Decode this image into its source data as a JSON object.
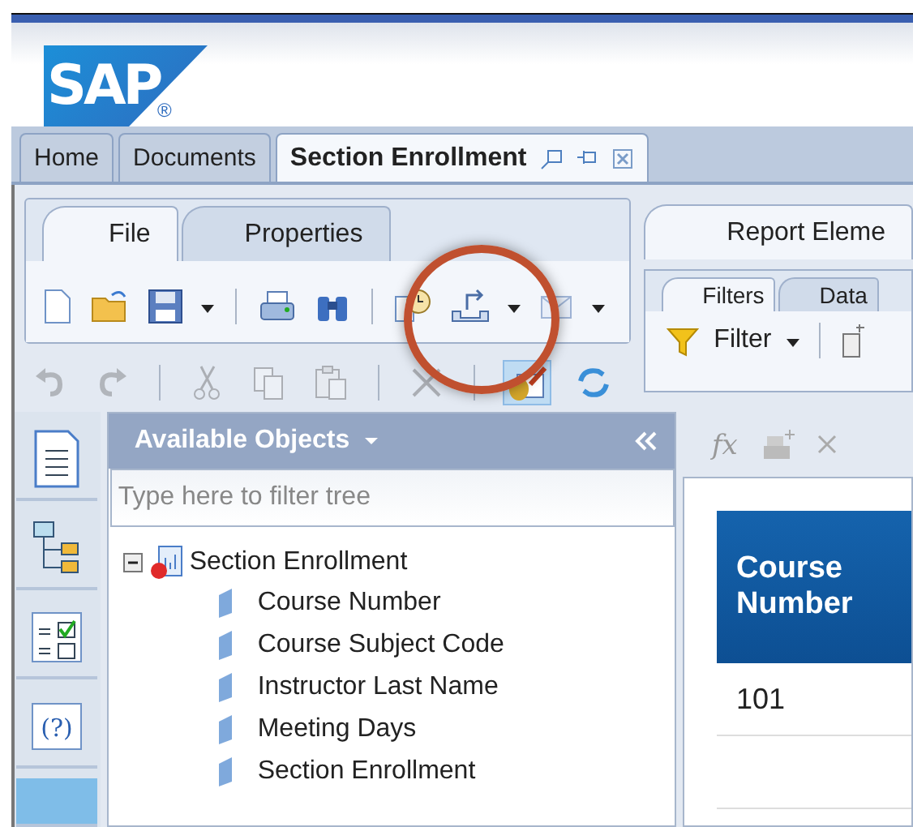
{
  "logo": {
    "text": "SAP",
    "mark": "®"
  },
  "tabs": [
    {
      "label": "Home",
      "selected": false
    },
    {
      "label": "Documents",
      "selected": false
    },
    {
      "label": "Section Enrollment",
      "selected": true
    }
  ],
  "ribbon_tabs": [
    {
      "label": "File",
      "selected": true
    },
    {
      "label": "Properties",
      "selected": false
    }
  ],
  "toolbar_row1": [
    {
      "kind": "new"
    },
    {
      "kind": "open"
    },
    {
      "kind": "save"
    },
    {
      "kind": "caret"
    },
    {
      "kind": "sep"
    },
    {
      "kind": "print"
    },
    {
      "kind": "find"
    },
    {
      "kind": "sep"
    },
    {
      "kind": "schedule"
    },
    {
      "kind": "export"
    },
    {
      "kind": "caret"
    },
    {
      "kind": "mail"
    },
    {
      "kind": "caret"
    }
  ],
  "toolbar_row2": [
    {
      "kind": "undo",
      "disabled": true
    },
    {
      "kind": "redo",
      "disabled": true
    },
    {
      "kind": "sep"
    },
    {
      "kind": "cut",
      "disabled": true
    },
    {
      "kind": "copy",
      "disabled": true
    },
    {
      "kind": "paste",
      "disabled": true
    },
    {
      "kind": "sep"
    },
    {
      "kind": "delete",
      "disabled": true
    },
    {
      "kind": "sep"
    },
    {
      "kind": "design",
      "disabled": false
    },
    {
      "kind": "refresh",
      "disabled": false
    }
  ],
  "right_ribbon_tabs": [
    {
      "label": "Report Eleme",
      "selected": true
    }
  ],
  "sub_tabs": [
    {
      "label": "Filters",
      "selected": true
    },
    {
      "label": "Data",
      "selected": false
    }
  ],
  "filter_button": {
    "label": "Filter"
  },
  "side_icons": [
    {
      "kind": "document",
      "selected": false
    },
    {
      "kind": "tree",
      "selected": false
    },
    {
      "kind": "checklist",
      "selected": false
    },
    {
      "kind": "help",
      "selected": false,
      "glyph": "(?)"
    },
    {
      "kind": "blank",
      "selected": true
    }
  ],
  "objects_panel": {
    "title": "Available Objects",
    "placeholder": "Type here to filter tree",
    "tree": [
      {
        "label": "Section Enrollment",
        "expanded": true,
        "children": [
          {
            "label": "Course Number"
          },
          {
            "label": "Course Subject Code"
          },
          {
            "label": "Instructor Last Name"
          },
          {
            "label": "Meeting Days"
          },
          {
            "label": "Section Enrollment"
          }
        ]
      }
    ]
  },
  "report_toolbar": {
    "formula": "fx"
  },
  "table": {
    "columns": [
      "Course Number"
    ],
    "rows": [
      [
        "101"
      ],
      [
        ""
      ]
    ]
  }
}
